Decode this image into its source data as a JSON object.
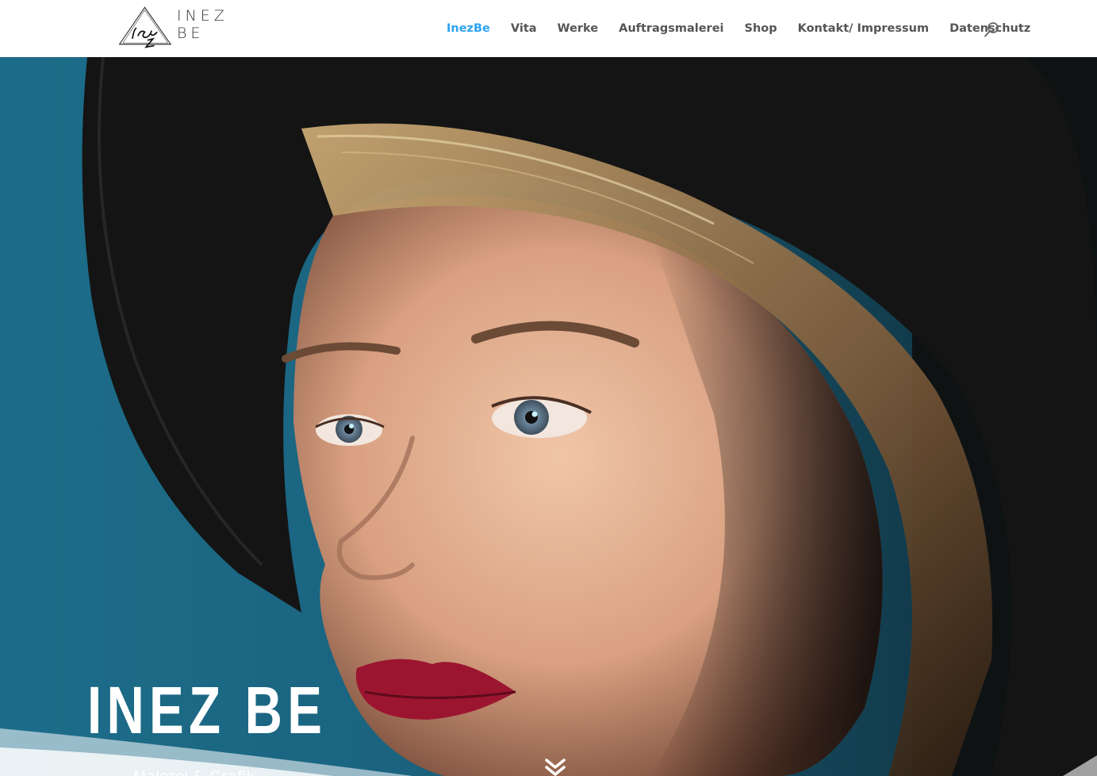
{
  "brand": {
    "logo_text": "INEZ BE",
    "logo_icon": "triangle-signature-logo"
  },
  "nav": {
    "items": [
      {
        "label": "InezBe",
        "active": true
      },
      {
        "label": "Vita",
        "active": false
      },
      {
        "label": "Werke",
        "active": false
      },
      {
        "label": "Auftragsmalerei",
        "active": false
      },
      {
        "label": "Shop",
        "active": false
      },
      {
        "label": "Kontakt/ Impressum",
        "active": false
      },
      {
        "label": "Datenschutz",
        "active": false
      }
    ],
    "search_icon": "search-icon"
  },
  "hero": {
    "title": "INEZ BE",
    "subtitle": "Malerei & Grafik",
    "scroll_icon": "double-chevron-down-icon"
  },
  "colors": {
    "accent": "#2ea3f2",
    "nav_text": "#555555",
    "hero_background": "#1f6f8b",
    "hat": "#151515",
    "lips": "#9c1530"
  }
}
